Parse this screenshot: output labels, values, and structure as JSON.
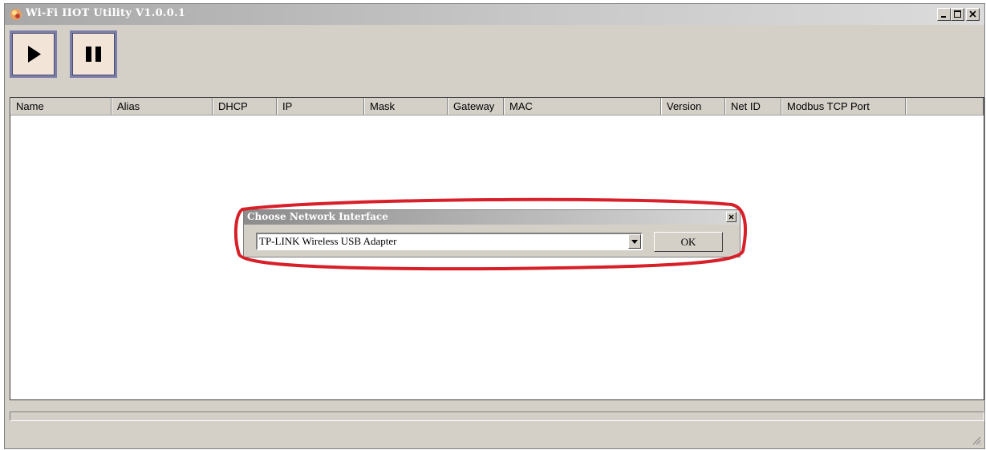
{
  "window": {
    "title": "Wi-Fi IIOT Utility V1.0.0.1"
  },
  "toolbar": {
    "play_icon": "play-icon",
    "pause_icon": "pause-icon"
  },
  "table": {
    "columns": [
      "Name",
      "Alias",
      "DHCP",
      "IP",
      "Mask",
      "Gateway",
      "MAC",
      "Version",
      "Net ID",
      "Modbus TCP Port"
    ],
    "rows": []
  },
  "dialog": {
    "title": "Choose Network Interface",
    "selected_interface": "TP-LINK Wireless USB Adapter",
    "ok_label": "OK"
  },
  "colors": {
    "highlight": "#d8202a",
    "titlebar": "#a8a8a8",
    "toolbar_button_face": "#f3e4d8"
  }
}
